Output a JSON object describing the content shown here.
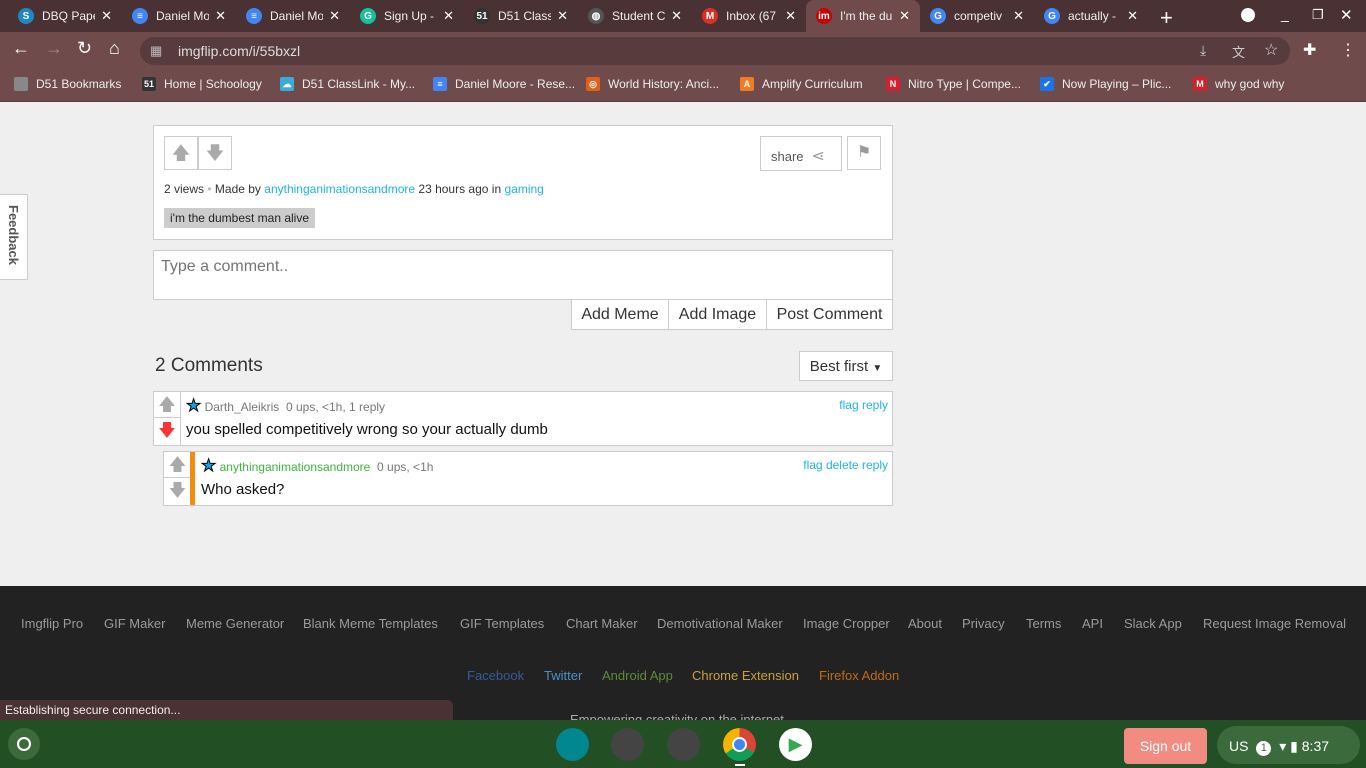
{
  "browser": {
    "tabs": [
      {
        "title": "DBQ Paper",
        "color": "#1e88c4",
        "glyph": "S"
      },
      {
        "title": "Daniel Moore",
        "color": "#4285f4",
        "glyph": "≡"
      },
      {
        "title": "Daniel Moore",
        "color": "#4285f4",
        "glyph": "≡"
      },
      {
        "title": "Sign Up -",
        "color": "#15c39a",
        "glyph": "G"
      },
      {
        "title": "D51 Class",
        "color": "#333",
        "glyph": "51"
      },
      {
        "title": "Student C",
        "color": "#555",
        "glyph": "◍"
      },
      {
        "title": "Inbox (67",
        "color": "#d93025",
        "glyph": "M"
      },
      {
        "title": "I'm the du",
        "color": "#cc0000",
        "glyph": "im"
      },
      {
        "title": "competiv",
        "color": "#4285f4",
        "glyph": "G"
      },
      {
        "title": "actually -",
        "color": "#4285f4",
        "glyph": "G"
      }
    ],
    "url": "imgflip.com/i/55bxzl",
    "bookmarks": [
      {
        "label": "D51 Bookmarks",
        "color": "#888",
        "glyph": ""
      },
      {
        "label": "Home | Schoology",
        "color": "#333",
        "glyph": "51"
      },
      {
        "label": "D51 ClassLink - My...",
        "color": "#3aa9de",
        "glyph": "☁"
      },
      {
        "label": "Daniel Moore - Rese...",
        "color": "#4285f4",
        "glyph": "≡"
      },
      {
        "label": "World History: Anci...",
        "color": "#e25e1b",
        "glyph": "◎"
      },
      {
        "label": "Amplify Curriculum",
        "color": "#f47b20",
        "glyph": "A"
      },
      {
        "label": "Nitro Type | Compe...",
        "color": "#d3202c",
        "glyph": "N"
      },
      {
        "label": "Now Playing – Plic...",
        "color": "#1a73e8",
        "glyph": "✔"
      },
      {
        "label": "why god why",
        "color": "#d3202c",
        "glyph": "M"
      }
    ]
  },
  "post": {
    "views": "2 views",
    "made_by": "Made by",
    "author": "anythinganimationsandmore",
    "time": "23 hours ago in",
    "stream": "gaming",
    "tag": "i'm the dumbest man alive",
    "share": "share"
  },
  "comment_form": {
    "placeholder": "Type a comment..",
    "add_meme": "Add Meme",
    "add_image": "Add Image",
    "post": "Post Comment"
  },
  "comments_header": {
    "count": "2 Comments",
    "sort": "Best first"
  },
  "comments": [
    {
      "user": "Darth_Aleikris",
      "meta": "0 ups, <1h, 1 reply",
      "text": "you spelled competitively wrong so your actually dumb",
      "flag": "flag",
      "reply": "reply"
    },
    {
      "user": "anythinganimationsandmore",
      "meta": "0 ups, <1h",
      "text": "Who asked?",
      "flag": "flag",
      "delete": "delete",
      "reply": "reply"
    }
  ],
  "feedback": "Feedback",
  "footer": {
    "links": [
      "Imgflip Pro",
      "GIF Maker",
      "Meme Generator",
      "Blank Meme Templates",
      "GIF Templates",
      "Chart Maker",
      "Demotivational Maker",
      "Image Cropper",
      "About",
      "Privacy",
      "Terms",
      "API",
      "Slack App",
      "Request Image Removal"
    ],
    "social": [
      {
        "label": "Facebook",
        "color": "#3b5998"
      },
      {
        "label": "Twitter",
        "color": "#4a90c8"
      },
      {
        "label": "Android App",
        "color": "#5d8a3a"
      },
      {
        "label": "Chrome Extension",
        "color": "#c8a040"
      },
      {
        "label": "Firefox Addon",
        "color": "#c06a1a"
      }
    ],
    "tagline": "Empowering creativity on the internet"
  },
  "status": "Establishing secure connection...",
  "taskbar": {
    "signout": "Sign out",
    "lang": "US",
    "notifications": "1",
    "time": "8:37"
  }
}
